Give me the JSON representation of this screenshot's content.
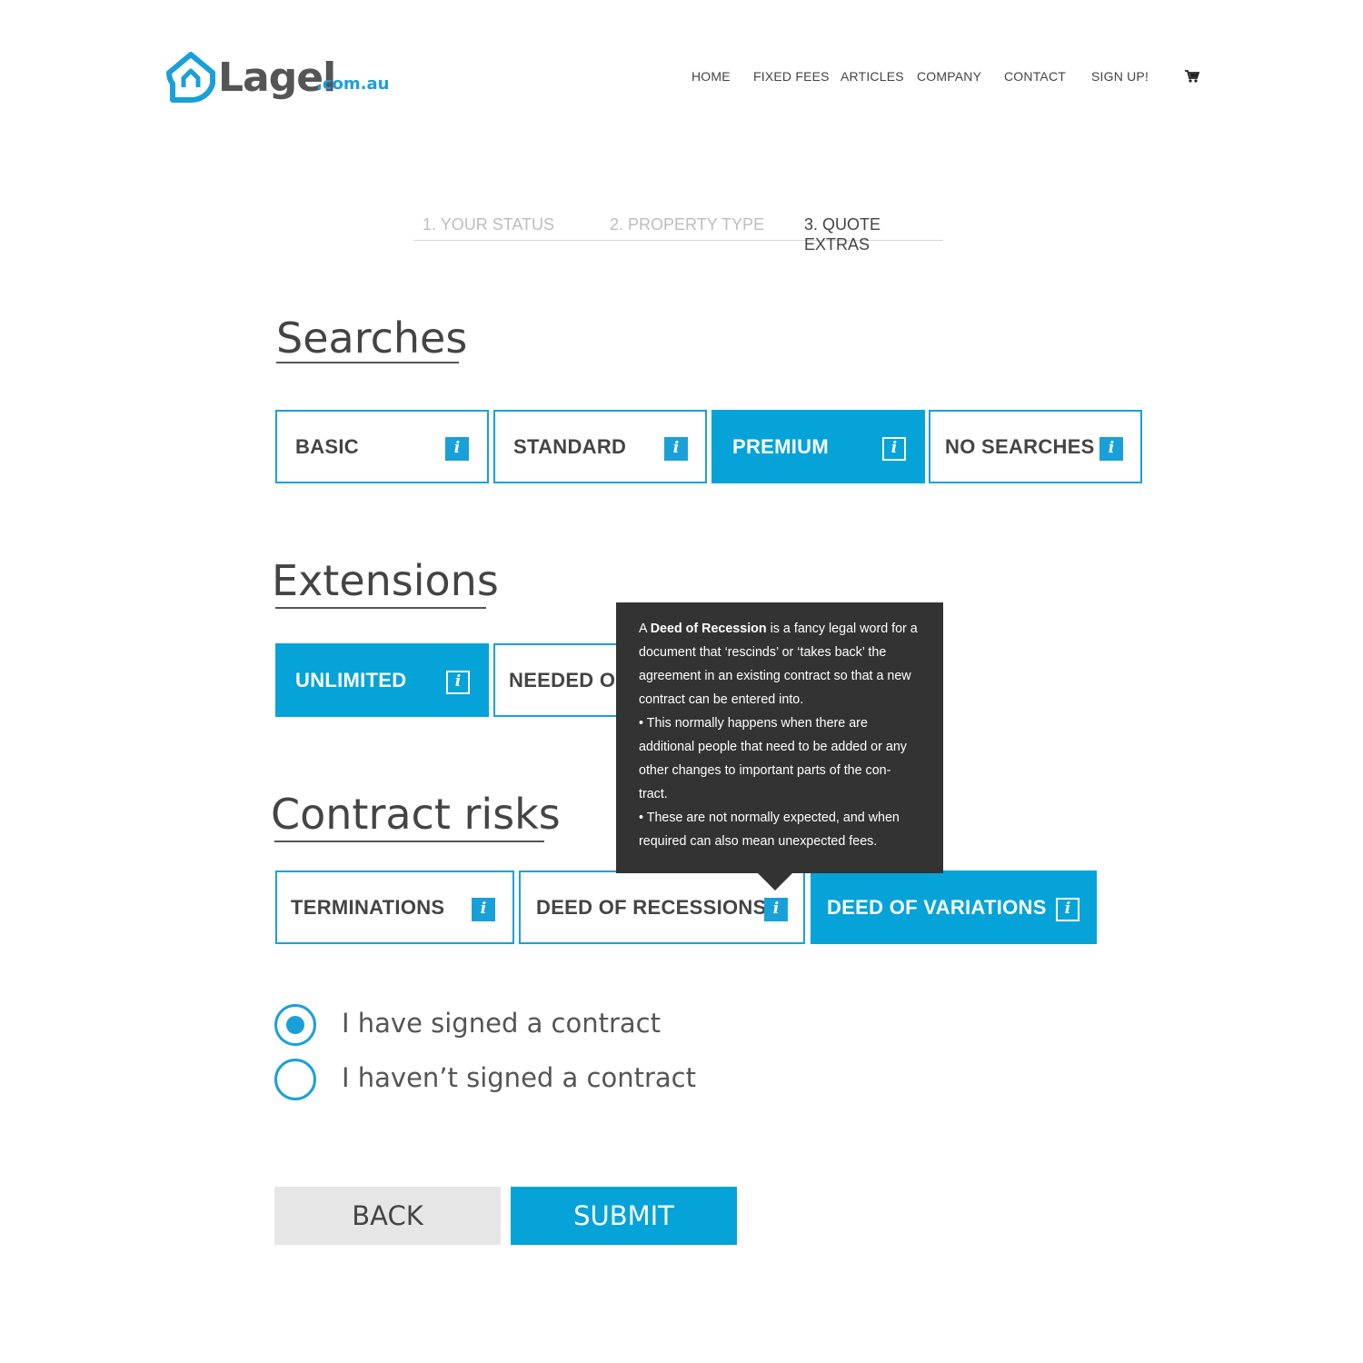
{
  "logo": {
    "name": "Lagel",
    "domain": ".com.au"
  },
  "nav": {
    "items": [
      "HOME",
      "FIXED FEES",
      "ARTICLES",
      "COMPANY",
      "CONTACT",
      "SIGN UP!"
    ],
    "cart_icon": "shopping-cart-icon"
  },
  "steps": [
    {
      "label": "1. YOUR STATUS",
      "active": false
    },
    {
      "label": "2. PROPERTY TYPE",
      "active": false
    },
    {
      "label": "3. QUOTE EXTRAS",
      "active": true
    }
  ],
  "searches": {
    "title": "Searches",
    "options": [
      {
        "label": "BASIC",
        "selected": false
      },
      {
        "label": "STANDARD",
        "selected": false
      },
      {
        "label": "PREMIUM",
        "selected": true
      },
      {
        "label": "NO SEARCHES",
        "selected": false
      }
    ]
  },
  "extensions": {
    "title": "Extensions",
    "options": [
      {
        "label": "UNLIMITED",
        "selected": true
      },
      {
        "label": "NEEDED ON",
        "selected": false
      }
    ]
  },
  "contract_risks": {
    "title": "Contract risks",
    "options": [
      {
        "label": "TERMINATIONS",
        "selected": false
      },
      {
        "label": "DEED OF RECESSIONS",
        "selected": false
      },
      {
        "label": "DEED OF VARIATIONS",
        "selected": true
      }
    ]
  },
  "info_icon_glyph": "i",
  "tooltip": {
    "prefix": "A ",
    "term": "Deed of Recession",
    "line1_rest": " is a fancy legal word for a",
    "lines": [
      "document that ‘rescinds’ or ‘takes back’ the",
      "agreement in an existing contract so that a new",
      "contract can be entered into.",
      "•  This normally happens when there are",
      "additional people that need to be added or any",
      "other changes to important parts of the con-",
      "tract.",
      "•  These are not normally expected, and when",
      "required can also mean unexpected fees."
    ]
  },
  "contract_status": {
    "options": [
      {
        "label": "I have signed a contract",
        "checked": true
      },
      {
        "label": "I haven’t signed a contract",
        "checked": false
      }
    ]
  },
  "buttons": {
    "back": "BACK",
    "submit": "SUBMIT"
  },
  "colors": {
    "accent": "#05a3d8",
    "text": "#444444",
    "tooltip_bg": "#333333",
    "back_bg": "#e6e6e6"
  }
}
